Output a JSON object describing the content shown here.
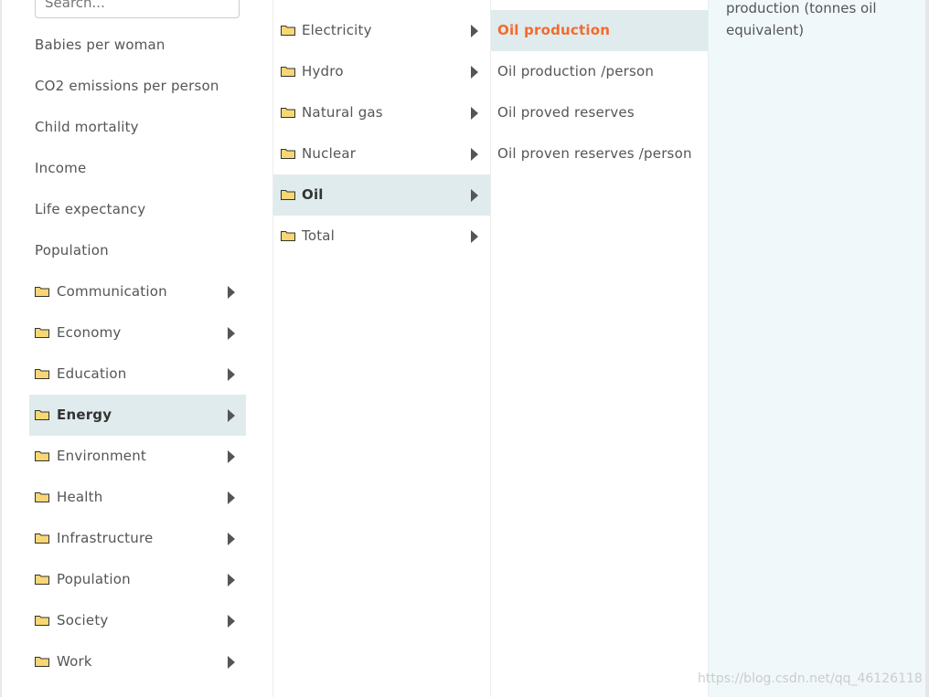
{
  "search": {
    "placeholder": "Search..."
  },
  "column1": {
    "items": [
      {
        "label": "Babies per woman"
      },
      {
        "label": "CO2 emissions per person"
      },
      {
        "label": "Child mortality"
      },
      {
        "label": "Income"
      },
      {
        "label": "Life expectancy"
      },
      {
        "label": "Population"
      },
      {
        "label": "Communication"
      },
      {
        "label": "Economy"
      },
      {
        "label": "Education"
      },
      {
        "label": "Energy"
      },
      {
        "label": "Environment"
      },
      {
        "label": "Health"
      },
      {
        "label": "Infrastructure"
      },
      {
        "label": "Population"
      },
      {
        "label": "Society"
      },
      {
        "label": "Work"
      }
    ]
  },
  "column2": {
    "items": [
      {
        "label": "Electricity"
      },
      {
        "label": "Hydro"
      },
      {
        "label": "Natural gas"
      },
      {
        "label": "Nuclear"
      },
      {
        "label": "Oil"
      },
      {
        "label": "Total"
      }
    ]
  },
  "column3": {
    "items": [
      {
        "label": "Oil production"
      },
      {
        "label": "Oil production /person"
      },
      {
        "label": "Oil proved reserves"
      },
      {
        "label": "Oil proven reserves /person"
      }
    ]
  },
  "column4": {
    "description": "production (tonnes oil equivalent)"
  },
  "watermark": "https://blog.csdn.net/qq_46126118",
  "colors": {
    "accent_selected": "#f26b2f",
    "active_row": "#e0ebed",
    "detail_panel": "#f1f8fa",
    "folder_fill": "#f7d774"
  }
}
